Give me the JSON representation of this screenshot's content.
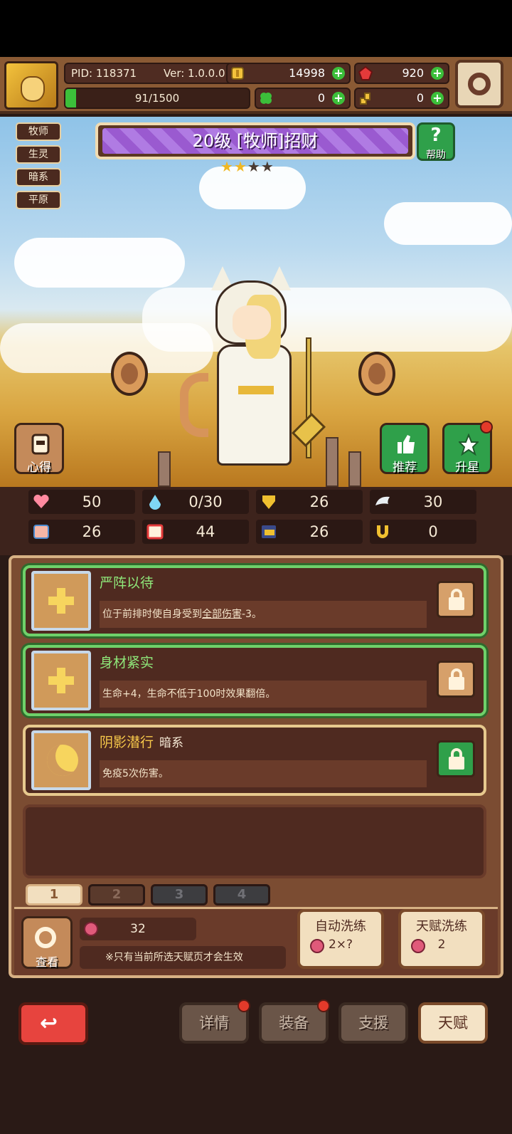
{
  "header": {
    "pid": "PID: 118371",
    "version": "Ver: 1.0.0.0",
    "stamina": "91/1500",
    "stamina_fraction": 0.06,
    "coins": "14998",
    "gems": "920",
    "clovers": "0",
    "keys": "0"
  },
  "tags": [
    "牧师",
    "生灵",
    "暗系",
    "平原"
  ],
  "hero": {
    "title": "20级 [牧师]招财",
    "stars_filled": 2,
    "stars_total": 4
  },
  "buttons": {
    "help": "帮助",
    "insight": "心得",
    "recommend": "推荐",
    "star_up": "升星"
  },
  "stats": [
    {
      "icon": "heart-icon",
      "value": "50"
    },
    {
      "icon": "mana-drop-icon",
      "value": "0/30"
    },
    {
      "icon": "shield-icon",
      "value": "26"
    },
    {
      "icon": "wing-icon",
      "value": "30"
    },
    {
      "icon": "fist-icon",
      "value": "26"
    },
    {
      "icon": "book-icon",
      "value": "44"
    },
    {
      "icon": "boot-icon",
      "value": "26"
    },
    {
      "icon": "horseshoe-icon",
      "value": "0"
    }
  ],
  "talents": [
    {
      "name": "严阵以待",
      "sub": "",
      "desc_pre": "位于前排时使自身受到",
      "desc_link": "全部伤害",
      "desc_post": "-3。",
      "locked": false
    },
    {
      "name": "身材紧实",
      "sub": "",
      "desc_pre": "生命+4，生命不低于100时效果翻倍。",
      "desc_link": "",
      "desc_post": "",
      "locked": false
    },
    {
      "name": "阴影潜行",
      "sub": "暗系",
      "desc_pre": "免疫5次伤害。",
      "desc_link": "",
      "desc_post": "",
      "locked": true
    }
  ],
  "pages": [
    "1",
    "2",
    "3",
    "4"
  ],
  "lower": {
    "view": "查看",
    "fruit_count": "32",
    "note": "※只有当前所选天赋页才会生效",
    "auto_reroll_label": "自动洗练",
    "auto_reroll_cost": "2×?",
    "talent_reroll_label": "天赋洗练",
    "talent_reroll_cost": "2"
  },
  "nav": {
    "details": "详情",
    "equip": "装备",
    "support": "支援",
    "talent": "天赋"
  }
}
